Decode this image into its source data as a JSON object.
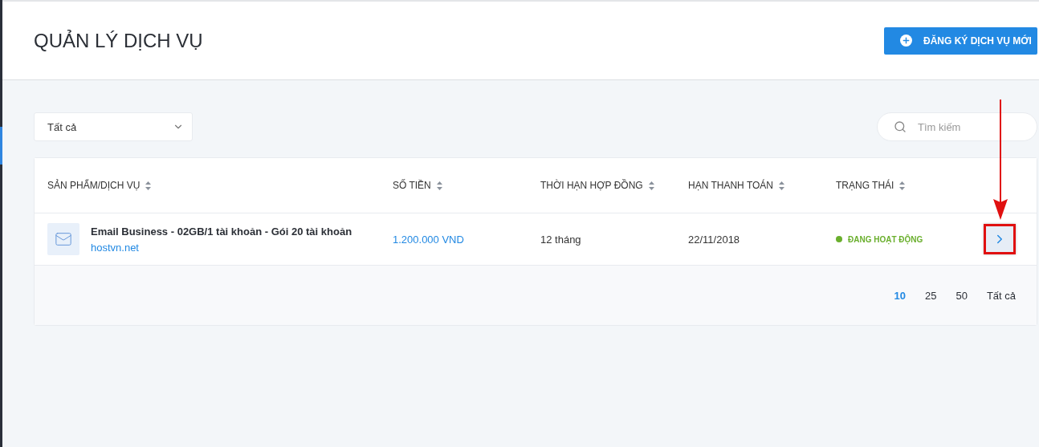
{
  "page": {
    "title": "QUẢN LÝ DỊCH VỤ",
    "new_service_button": "ĐĂNG KÝ DỊCH VỤ MỚI"
  },
  "filter": {
    "value": "Tất cả"
  },
  "search": {
    "placeholder": "Tìm kiếm"
  },
  "table": {
    "columns": [
      {
        "label": "SẢN PHẨM/DỊCH VỤ",
        "sortable": true
      },
      {
        "label": "SỐ TIỀN",
        "sortable": true
      },
      {
        "label": "THỜI HẠN HỢP ĐỒNG",
        "sortable": true
      },
      {
        "label": "HẠN THANH TOÁN",
        "sortable": true
      },
      {
        "label": "TRẠNG THÁI",
        "sortable": true
      }
    ],
    "rows": [
      {
        "name": "Email Business - 02GB/1 tài khoản - Gói 20 tài khoản",
        "domain": "hostvn.net",
        "amount": "1.200.000 VND",
        "term": "12 tháng",
        "due": "22/11/2018",
        "status": {
          "label": "ĐANG HOẠT ĐỘNG",
          "color": "#6aaf2d"
        },
        "highlighted": true
      }
    ]
  },
  "page_sizes": [
    {
      "label": "10",
      "selected": true
    },
    {
      "label": "25",
      "selected": false
    },
    {
      "label": "50",
      "selected": false
    },
    {
      "label": "Tất cả",
      "selected": false
    }
  ]
}
